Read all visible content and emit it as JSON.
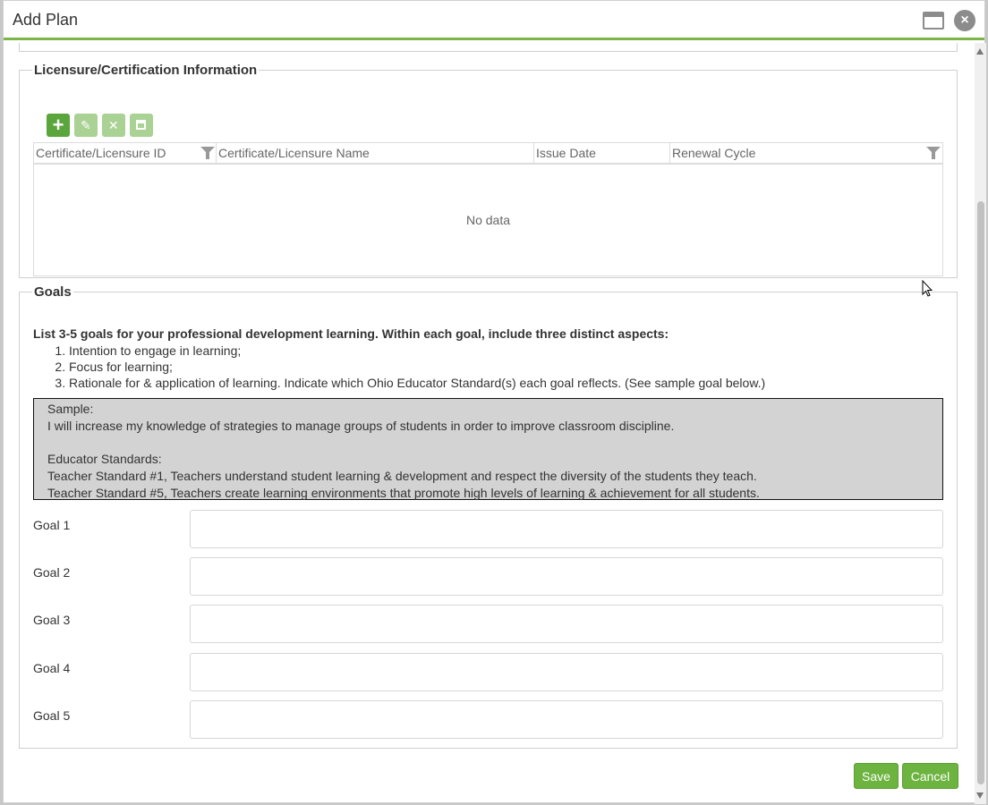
{
  "window": {
    "title": "Add Plan",
    "maximize_icon": "window-maximize-icon",
    "close_icon": "close-circle-icon"
  },
  "licensure": {
    "legend": "Licensure/Certification Information",
    "toolbar": {
      "add_icon": "plus-icon",
      "edit_icon": "pencil-icon",
      "delete_icon": "x-icon",
      "save_icon": "save-icon"
    },
    "columns": [
      "Certificate/Licensure ID",
      "Certificate/Licensure Name",
      "Issue Date",
      "Renewal Cycle"
    ],
    "empty_text": "No data"
  },
  "goals": {
    "legend": "Goals",
    "lead": "List 3-5 goals for your professional development learning. Within each goal, include three distinct aspects:",
    "aspects": [
      "Intention to engage in learning;",
      "Focus for learning;",
      "Rationale for & application of learning. Indicate which Ohio Educator Standard(s) each goal reflects. (See sample goal below.)"
    ],
    "sample": {
      "label": "Sample:",
      "goal": "I will increase my knowledge of strategies to manage groups of students in order to improve classroom discipline.",
      "standards_label": "Educator Standards:",
      "standards": [
        "Teacher Standard #1, Teachers understand student learning & development and respect the diversity of the students they teach.",
        "Teacher Standard #5, Teachers create learning environments that promote high levels of learning & achievement for all students."
      ]
    },
    "fields": [
      {
        "label": "Goal 1",
        "value": ""
      },
      {
        "label": "Goal 2",
        "value": ""
      },
      {
        "label": "Goal 3",
        "value": ""
      },
      {
        "label": "Goal 4",
        "value": ""
      },
      {
        "label": "Goal 5",
        "value": ""
      }
    ]
  },
  "actions": {
    "save_label": "Save",
    "cancel_label": "Cancel"
  },
  "colors": {
    "accent": "#7ab648",
    "button": "#6cb33f",
    "sample_bg": "#d3d3d3"
  }
}
